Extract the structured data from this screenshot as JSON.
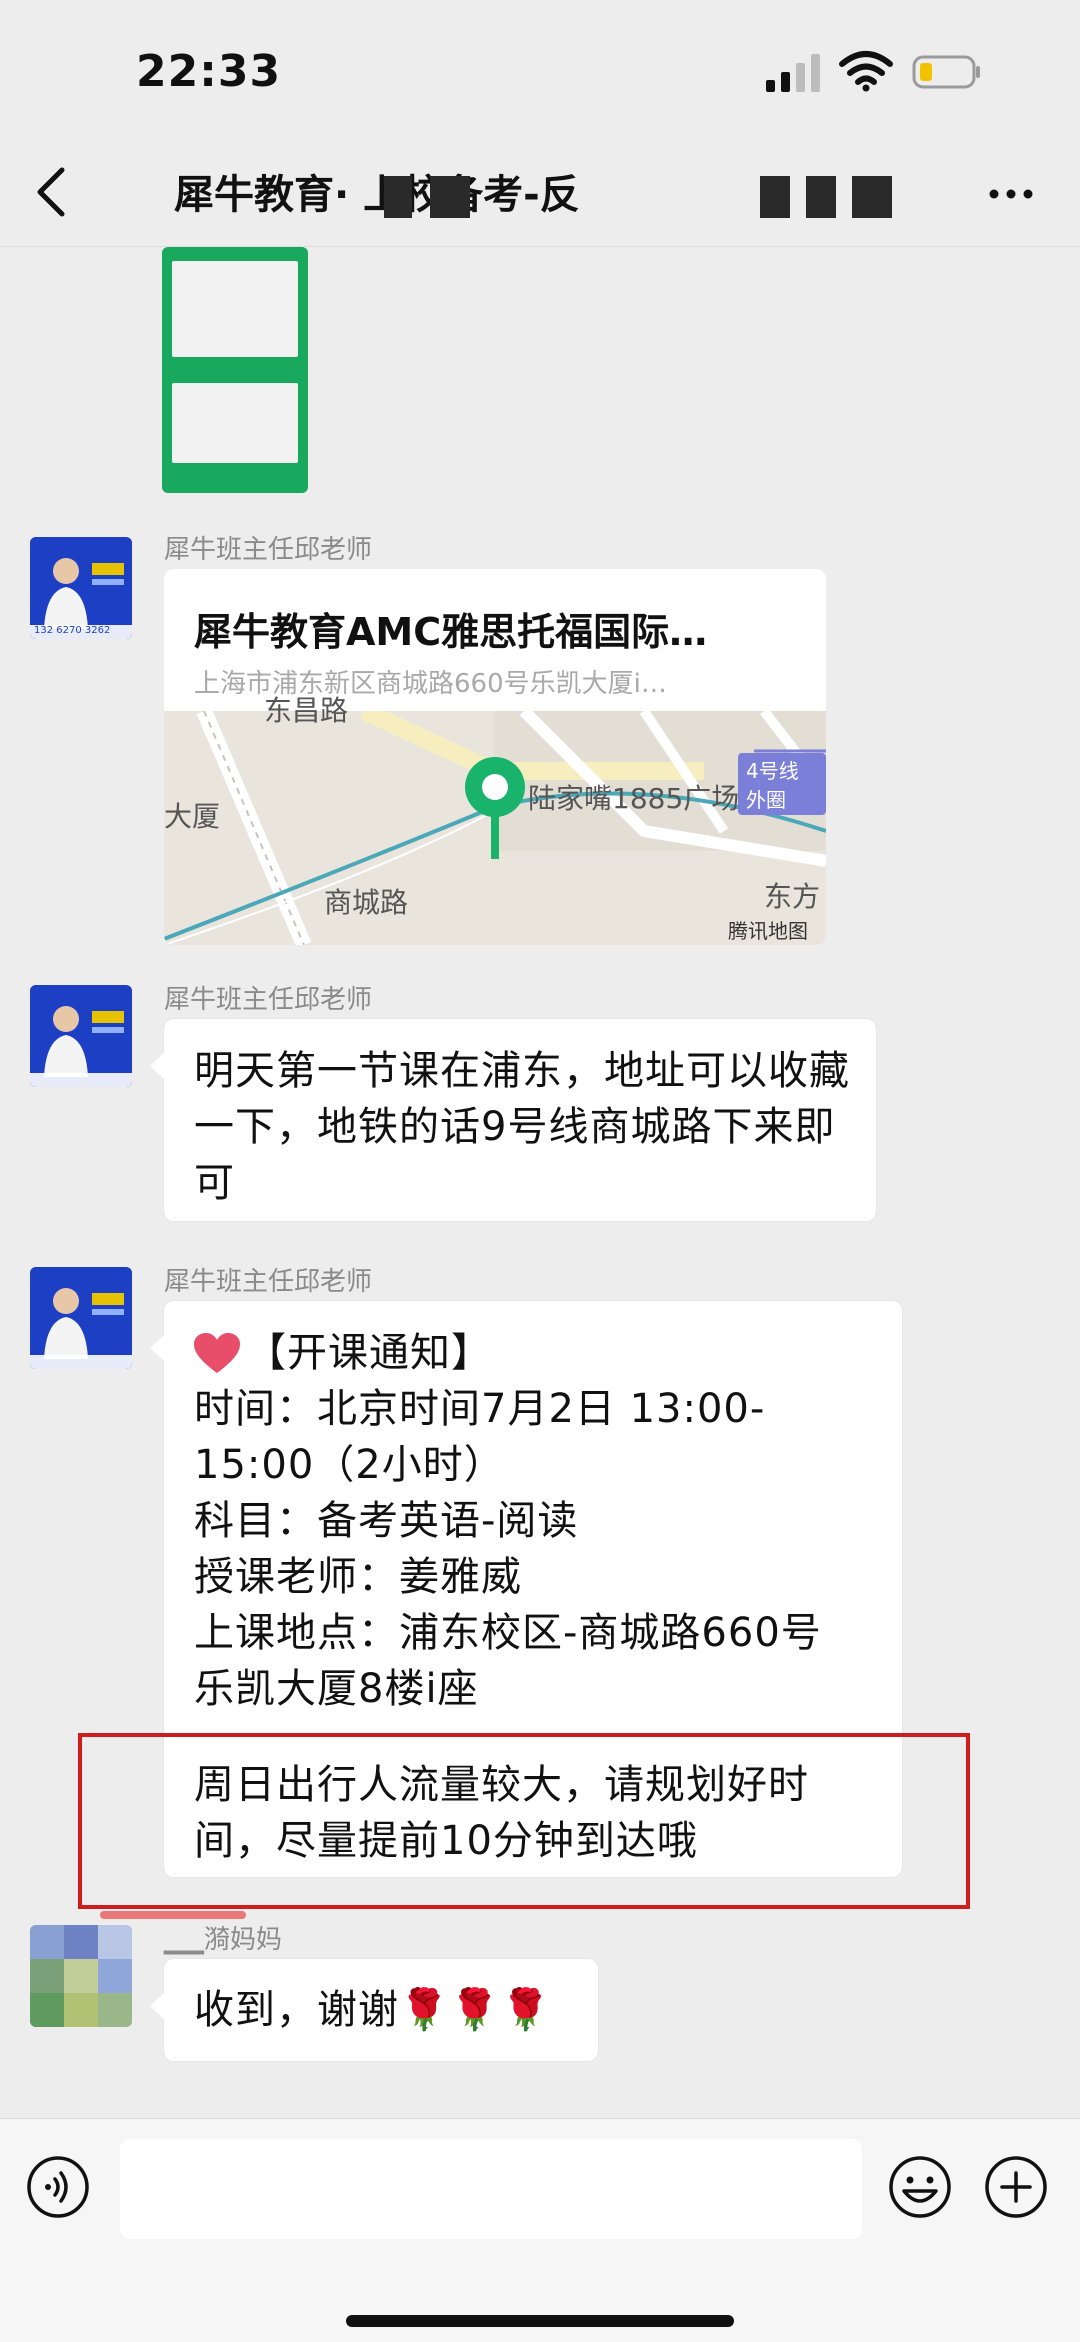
{
  "status_bar": {
    "time": "22:33"
  },
  "nav": {
    "title": "犀牛教育·      上校备考-反"
  },
  "messages": [
    {
      "sender": "犀牛班主任邱老师"
    },
    {
      "sender": "犀牛班主任邱老师",
      "text": "明天第一节课在浦东，地址可以收藏一下，地铁的话9号线商城路下来即可"
    },
    {
      "sender": "犀牛班主任邱老师"
    },
    {
      "sender": "▁▁漪妈妈",
      "text": "收到，谢谢🌹🌹🌹"
    }
  ],
  "location": {
    "title": "犀牛教育AMC雅思托福国际…",
    "address": "上海市浦东新区商城路660号乐凯大厦i…",
    "map_labels": [
      "东昌路",
      "大厦",
      "陆家嘴1885广场",
      "商城路",
      "东方",
      "4号线外圈",
      "腾讯地图"
    ]
  },
  "notice": {
    "heading": "【开课通知】",
    "lines": [
      "时间：北京时间7月2日 13:00-",
      "15:00（2小时）",
      "科目：备考英语-阅读",
      "授课老师：姜雅威",
      "上课地点：浦东校区-商城路660号",
      "乐凯大厦8楼i座"
    ],
    "tip_lines": [
      "周日出行人流量较大，请规划好时",
      "间，尽量提前10分钟到达哦"
    ]
  },
  "avatar_text": "132 6270 3262",
  "input": {
    "placeholder": ""
  },
  "colors": {
    "background": "#ededed",
    "highlight_box": "#cf1d1d",
    "map_pin": "#19b36b"
  }
}
